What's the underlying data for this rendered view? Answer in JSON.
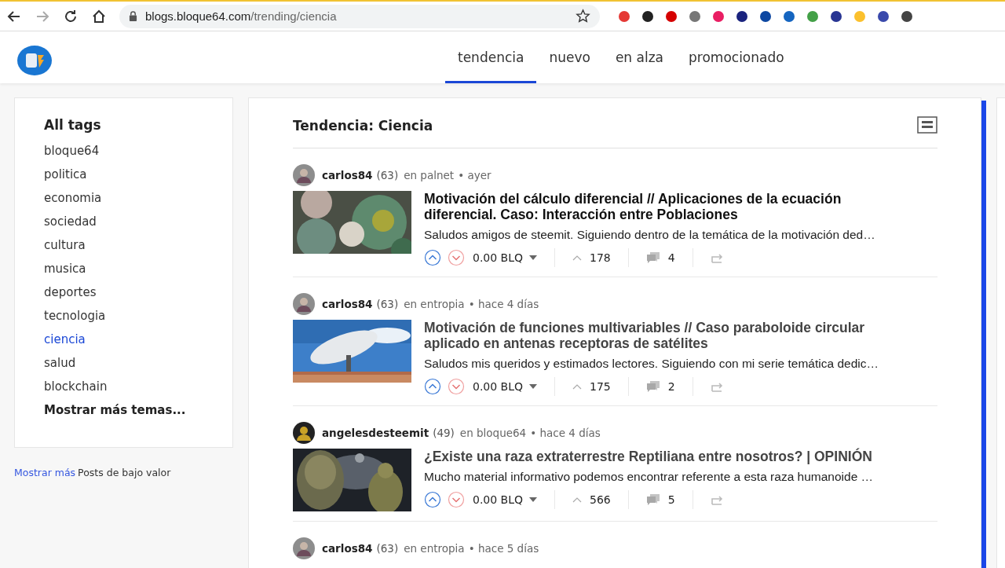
{
  "browser": {
    "url_host": "blogs.bloque64.com",
    "url_path": "/trending/ciencia",
    "forward_disabled": true
  },
  "nav": {
    "tabs": [
      {
        "label": "tendencia",
        "selected": true
      },
      {
        "label": "nuevo",
        "selected": false
      },
      {
        "label": "en alza",
        "selected": false
      },
      {
        "label": "promocionado",
        "selected": false
      }
    ]
  },
  "sidebar": {
    "title": "All tags",
    "tags": [
      {
        "label": "bloque64",
        "selected": false
      },
      {
        "label": "politica",
        "selected": false
      },
      {
        "label": "economia",
        "selected": false
      },
      {
        "label": "sociedad",
        "selected": false
      },
      {
        "label": "cultura",
        "selected": false
      },
      {
        "label": "musica",
        "selected": false
      },
      {
        "label": "deportes",
        "selected": false
      },
      {
        "label": "tecnologia",
        "selected": false
      },
      {
        "label": "ciencia",
        "selected": true
      },
      {
        "label": "salud",
        "selected": false
      },
      {
        "label": "blockchain",
        "selected": false
      }
    ],
    "more": "Mostrar más temas...",
    "footer_link": "Mostrar más",
    "footer_text": "Posts de bajo valor"
  },
  "feed": {
    "title": "Tendencia: Ciencia",
    "posts": [
      {
        "author": "carlos84",
        "rep": "(63)",
        "community": "en palnet",
        "time": "• ayer",
        "title": "Motivación del cálculo diferencial // Aplicaciones de la ecuación diferencial. Caso: Interacción entre Poblaciones",
        "visited": false,
        "excerpt": "Saludos amigos de steemit. Siguiendo dentro de la temática de la motivación ded…",
        "payout": "0.00 BLQ",
        "votes": "178",
        "comments": "4"
      },
      {
        "author": "carlos84",
        "rep": "(63)",
        "community": "en entropia",
        "time": "• hace 4 días",
        "title": "Motivación de funciones multivariables // Caso paraboloide circular aplicado en antenas receptoras de satélites",
        "visited": true,
        "excerpt": "Saludos mis queridos y estimados lectores. Siguiendo con mi serie temática dedic…",
        "payout": "0.00 BLQ",
        "votes": "175",
        "comments": "2"
      },
      {
        "author": "angelesdesteemit",
        "rep": "(49)",
        "community": "en bloque64",
        "time": "• hace 4 días",
        "title": "¿Existe una raza extraterrestre Reptiliana entre nosotros? | OPINIÓN",
        "visited": true,
        "excerpt": "Mucho material informativo podemos encontrar referente a esta raza humanoide …",
        "payout": "0.00 BLQ",
        "votes": "566",
        "comments": "5"
      },
      {
        "author": "carlos84",
        "rep": "(63)",
        "community": "en entropia",
        "time": "• hace 5 días"
      }
    ]
  }
}
